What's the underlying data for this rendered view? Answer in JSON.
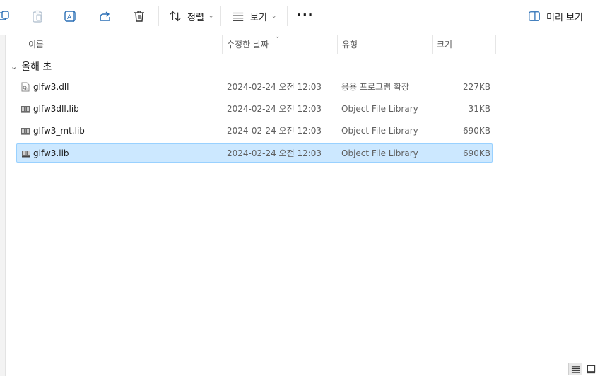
{
  "toolbar": {
    "sort_label": "정렬",
    "view_label": "보기",
    "more_label": "···",
    "preview_label": "미리 보기",
    "icons": [
      "copy-icon",
      "paste-icon",
      "rename-icon",
      "share-icon",
      "delete-icon",
      "sort-icon",
      "view-icon",
      "more-icon",
      "preview-pane-icon"
    ]
  },
  "columns": {
    "name": "이름",
    "modified": "수정한 날짜",
    "type": "유형",
    "size": "크기"
  },
  "group": {
    "label": "올해 초"
  },
  "files": [
    {
      "name": "glfw3.dll",
      "modified": "2024-02-24 오전 12:03",
      "type": "응용 프로그램 확장",
      "size": "227KB",
      "icon": "dll-file-icon"
    },
    {
      "name": "glfw3dll.lib",
      "modified": "2024-02-24 오전 12:03",
      "type": "Object File Library",
      "size": "31KB",
      "icon": "lib-file-icon"
    },
    {
      "name": "glfw3_mt.lib",
      "modified": "2024-02-24 오전 12:03",
      "type": "Object File Library",
      "size": "690KB",
      "icon": "lib-file-icon"
    },
    {
      "name": "glfw3.lib",
      "modified": "2024-02-24 오전 12:03",
      "type": "Object File Library",
      "size": "690KB",
      "icon": "lib-file-icon",
      "selected": true
    }
  ],
  "statusbar": {
    "icons": [
      "details-view-icon",
      "large-icons-view-icon"
    ]
  },
  "colors": {
    "selection_bg": "#cce8ff",
    "selection_border": "#99d1ff",
    "toolbar_bg": "#ffffff"
  }
}
